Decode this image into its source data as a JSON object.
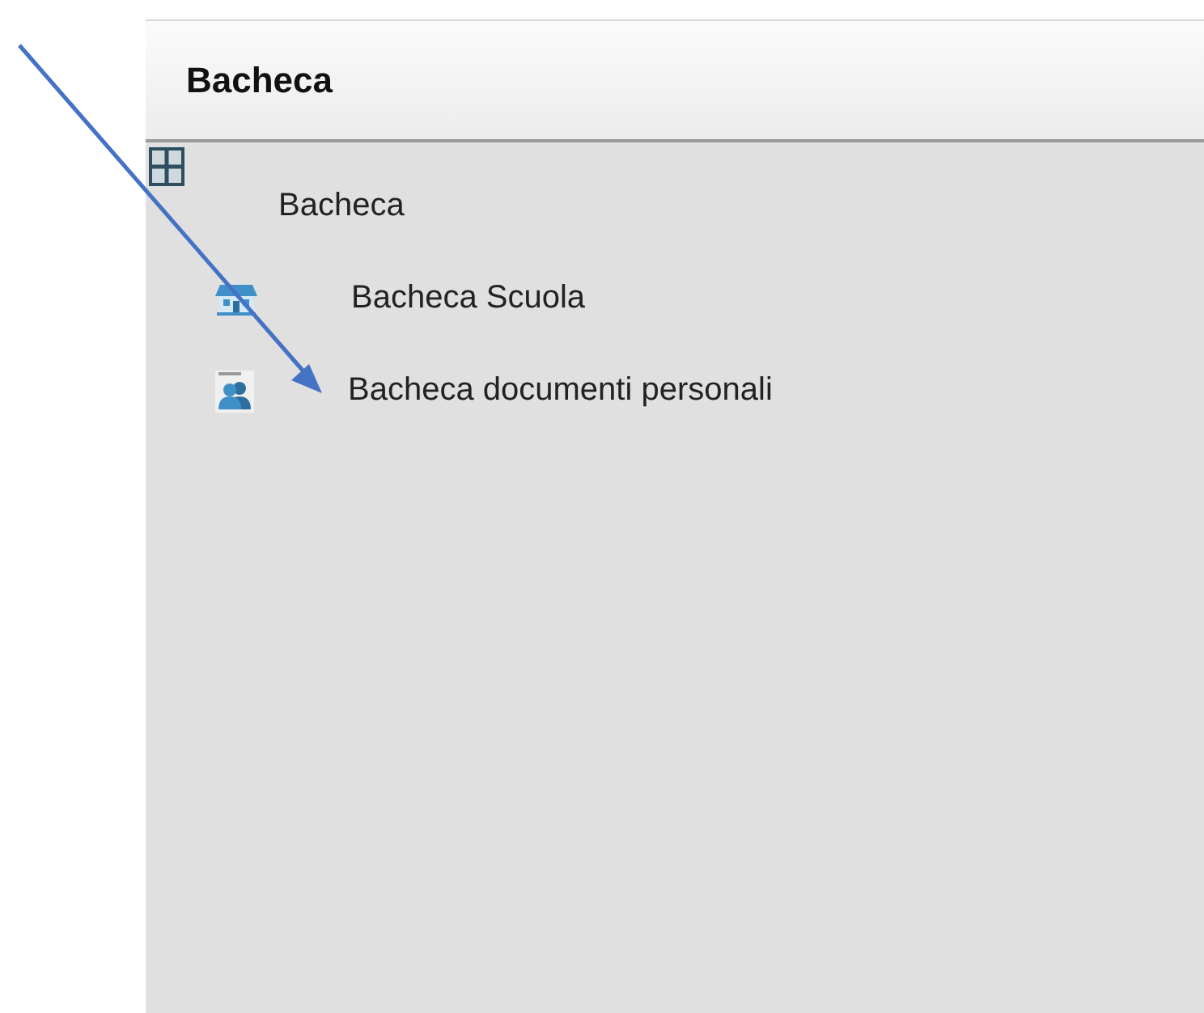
{
  "panel": {
    "title": "Bacheca"
  },
  "tree": [
    {
      "label": "Bacheca",
      "kind": "board",
      "children": [
        {
          "label": "Bacheca Scuola",
          "kind": "school"
        },
        {
          "label": "Bacheca documenti personali",
          "kind": "person"
        }
      ]
    }
  ]
}
